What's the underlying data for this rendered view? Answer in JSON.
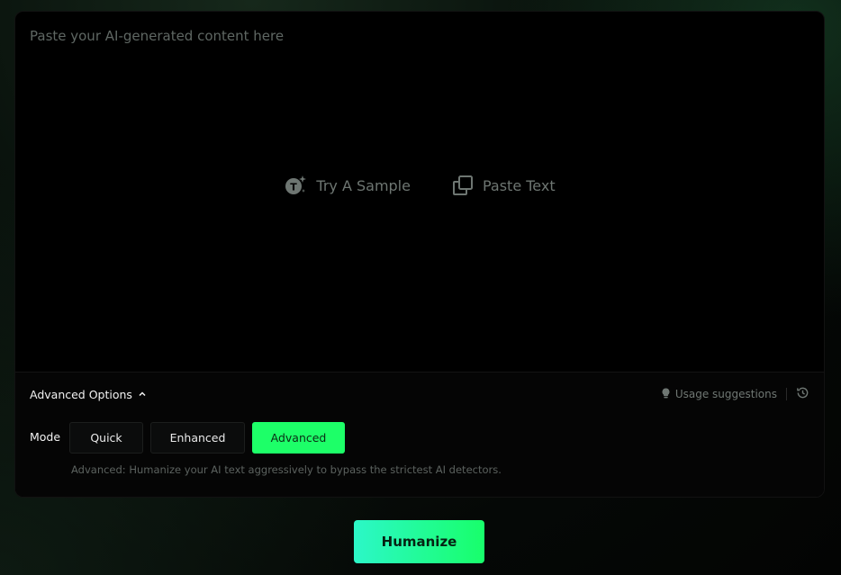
{
  "editor": {
    "placeholder": "Paste your AI-generated content here",
    "actions": {
      "sample_label": "Try A Sample",
      "paste_label": "Paste Text"
    }
  },
  "options": {
    "toggle_label": "Advanced Options",
    "usage_label": "Usage suggestions",
    "mode_label": "Mode",
    "modes": [
      "Quick",
      "Enhanced",
      "Advanced"
    ],
    "selected_mode": "Advanced",
    "mode_description": "Advanced: Humanize your AI text aggressively to bypass the strictest AI detectors."
  },
  "cta": {
    "label": "Humanize"
  },
  "colors": {
    "accent": "#1dff68",
    "cta_gradient_start": "#2cf7c8",
    "cta_gradient_end": "#18ff6a",
    "card_bg": "#000000",
    "muted_text": "#6e7672"
  },
  "icons": {
    "sample": "sparkle-t-icon",
    "paste": "copy-icon",
    "toggle": "chevron-up-icon",
    "usage": "lightbulb-icon",
    "history": "history-icon"
  }
}
